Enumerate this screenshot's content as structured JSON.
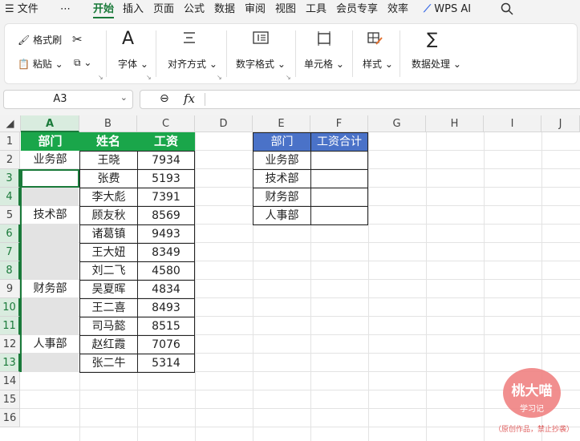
{
  "menu": {
    "file": "文件",
    "more": "⋯",
    "tabs": [
      "开始",
      "插入",
      "页面",
      "公式",
      "数据",
      "审阅",
      "视图",
      "工具",
      "会员专享",
      "效率"
    ],
    "wps_ai": "WPS AI"
  },
  "ribbon": {
    "format_painter": "格式刷",
    "paste": "粘贴",
    "font": "字体",
    "align": "对齐方式",
    "number_format": "数字格式",
    "cells": "单元格",
    "styles": "样式",
    "data_processing": "数据处理",
    "font_icon_char": "A",
    "fx": "fx"
  },
  "namebox": {
    "value": "A3"
  },
  "grid": {
    "columns": [
      "A",
      "B",
      "C",
      "D",
      "E",
      "F",
      "G",
      "H",
      "I",
      "J"
    ],
    "rows": [
      "1",
      "2",
      "3",
      "4",
      "5",
      "6",
      "7",
      "8",
      "9",
      "10",
      "11",
      "12",
      "13",
      "14",
      "15",
      "16"
    ],
    "headers": {
      "dept": "部门",
      "name": "姓名",
      "salary": "工资"
    },
    "dept_labels": {
      "r2": "业务部",
      "r5": "技术部",
      "r9": "财务部",
      "r12": "人事部"
    },
    "names": [
      "王晓",
      "张费",
      "李大彪",
      "顾友秋",
      "诸葛镇",
      "王大妞",
      "刘二飞",
      "吴夏晖",
      "王二喜",
      "司马懿",
      "赵红霞",
      "张二牛"
    ],
    "salaries": [
      "7934",
      "5193",
      "7391",
      "8569",
      "9493",
      "8349",
      "4580",
      "4834",
      "8493",
      "8515",
      "7076",
      "5314"
    ],
    "summary": {
      "header_dept": "部门",
      "header_total": "工资合计",
      "depts": [
        "业务部",
        "技术部",
        "财务部",
        "人事部"
      ]
    }
  },
  "watermark": {
    "title": "桃大喵",
    "sub": "学习记",
    "note": "（原创作品，禁止抄袭）"
  }
}
